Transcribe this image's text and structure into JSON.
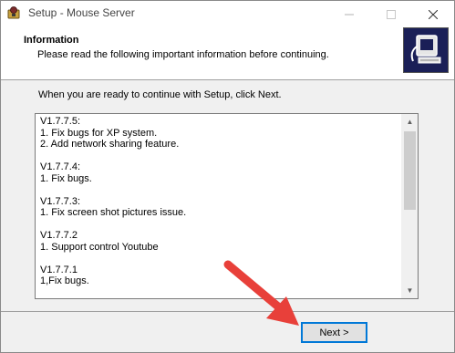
{
  "window": {
    "title": "Setup - Mouse Server",
    "minimize_icon": "minimize-icon",
    "maximize_icon": "maximize-icon",
    "close_icon": "close-icon"
  },
  "header": {
    "title": "Information",
    "subtitle": "Please read the following important information before continuing."
  },
  "main": {
    "intro": "When you are ready to continue with Setup, click Next.",
    "info_lines": [
      "V1.7.7.5:",
      "1. Fix bugs for XP system.",
      "2. Add network sharing feature.",
      "",
      "V1.7.7.4:",
      "1. Fix bugs.",
      "",
      "V1.7.7.3:",
      "1. Fix screen shot pictures issue.",
      "",
      "V1.7.7.2",
      "1. Support control Youtube",
      "",
      "V1.7.7.1",
      "1,Fix bugs."
    ]
  },
  "footer": {
    "next_label": "Next >"
  },
  "colors": {
    "accent": "#0078d7",
    "arrow": "#e8403a",
    "header_image_bg": "#1a1f57"
  }
}
